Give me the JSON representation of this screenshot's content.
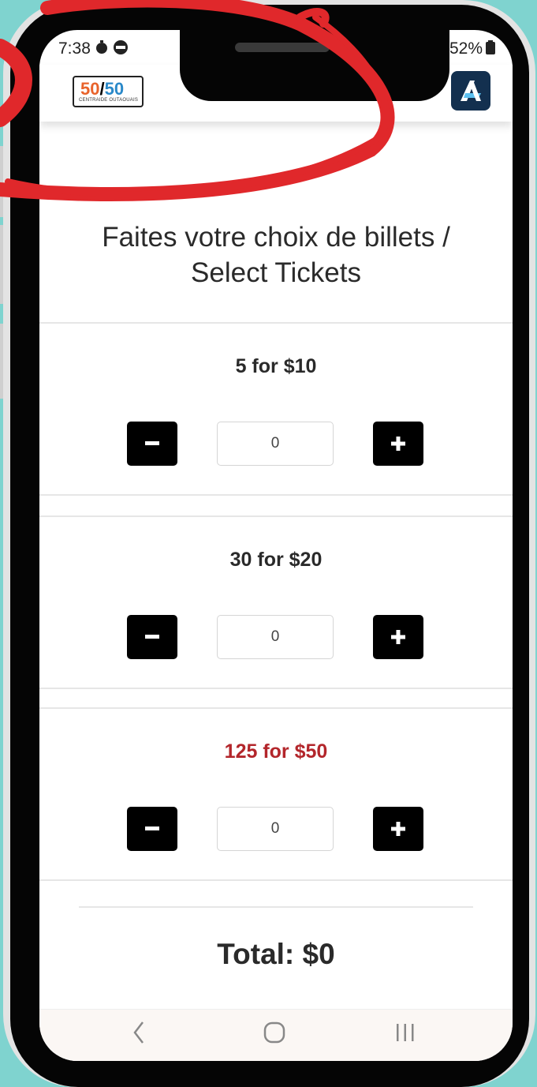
{
  "status_bar": {
    "time": "7:38",
    "battery": "52%",
    "icons": [
      "timer-icon",
      "message-icon",
      "wifi-icon",
      "signal-icon",
      "battery-icon"
    ]
  },
  "app_bar": {
    "logo": {
      "main_left": "50",
      "slash": "/",
      "main_right": "50",
      "subtitle": "CENTRAIDE OUTAOUAIS"
    },
    "app_icon": "app-logo-icon"
  },
  "page": {
    "title_line1": "Faites votre choix de billets /",
    "title_line2": "Select Tickets"
  },
  "tickets": [
    {
      "label": "5 for $10",
      "quantity": "0"
    },
    {
      "label": "30 for $20",
      "quantity": "0"
    },
    {
      "label": "125 for $50",
      "quantity": "0"
    }
  ],
  "total": {
    "text": "Total: $0"
  },
  "nav": {
    "back": "<",
    "home": "○",
    "recents": "|||"
  },
  "colors": {
    "background": "#7fd3cf",
    "highlight_label": "#b3262b",
    "annotation": "#e0282b",
    "button": "#000000"
  }
}
